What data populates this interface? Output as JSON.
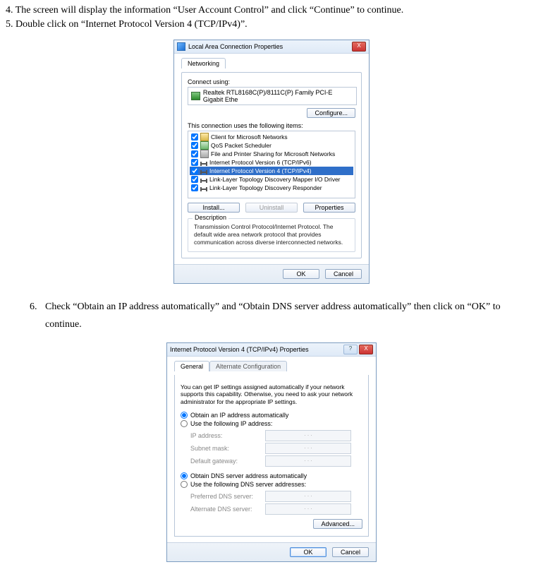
{
  "steps": {
    "s4": "4. The screen will display the information “User Account Control” and click “Continue” to continue.",
    "s5": "5. Double click on “Internet Protocol Version 4 (TCP/IPv4)”.",
    "s6": "Check “Obtain an IP address automatically” and “Obtain DNS server address automatically” then click on “OK” to continue."
  },
  "dlg1": {
    "title": "Local Area Connection Properties",
    "tab": "Networking",
    "connect_label": "Connect using:",
    "adapter": "Realtek RTL8168C(P)/8111C(P) Family PCI-E Gigabit Ethe",
    "configure": "Configure...",
    "items_label": "This connection uses the following items:",
    "items": [
      {
        "label": "Client for Microsoft Networks",
        "icon": "ic-client",
        "checked": true,
        "selected": false
      },
      {
        "label": "QoS Packet Scheduler",
        "icon": "ic-sched",
        "checked": true,
        "selected": false
      },
      {
        "label": "File and Printer Sharing for Microsoft Networks",
        "icon": "ic-share",
        "checked": true,
        "selected": false
      },
      {
        "label": "Internet Protocol Version 6 (TCP/IPv6)",
        "icon": "ic-proto",
        "checked": true,
        "selected": false
      },
      {
        "label": "Internet Protocol Version 4 (TCP/IPv4)",
        "icon": "ic-proto",
        "checked": true,
        "selected": true
      },
      {
        "label": "Link-Layer Topology Discovery Mapper I/O Driver",
        "icon": "ic-proto",
        "checked": true,
        "selected": false
      },
      {
        "label": "Link-Layer Topology Discovery Responder",
        "icon": "ic-proto",
        "checked": true,
        "selected": false
      }
    ],
    "install": "Install...",
    "uninstall": "Uninstall",
    "properties": "Properties",
    "desc_title": "Description",
    "desc_text": "Transmission Control Protocol/Internet Protocol. The default wide area network protocol that provides communication across diverse interconnected networks.",
    "ok": "OK",
    "cancel": "Cancel",
    "close_x": "X"
  },
  "dlg2": {
    "title": "Internet Protocol Version 4 (TCP/IPv4) Properties",
    "tab_general": "General",
    "tab_alt": "Alternate Configuration",
    "intro": "You can get IP settings assigned automatically if your network supports this capability. Otherwise, you need to ask your network administrator for the appropriate IP settings.",
    "r_auto_ip": "Obtain an IP address automatically",
    "r_use_ip": "Use the following IP address:",
    "f_ip": "IP address:",
    "f_mask": "Subnet mask:",
    "f_gw": "Default gateway:",
    "r_auto_dns": "Obtain DNS server address automatically",
    "r_use_dns": "Use the following DNS server addresses:",
    "f_pref_dns": "Preferred DNS server:",
    "f_alt_dns": "Alternate DNS server:",
    "dots": ".       .       .",
    "advanced": "Advanced...",
    "ok": "OK",
    "cancel": "Cancel",
    "help_q": "?",
    "close_x": "X"
  }
}
